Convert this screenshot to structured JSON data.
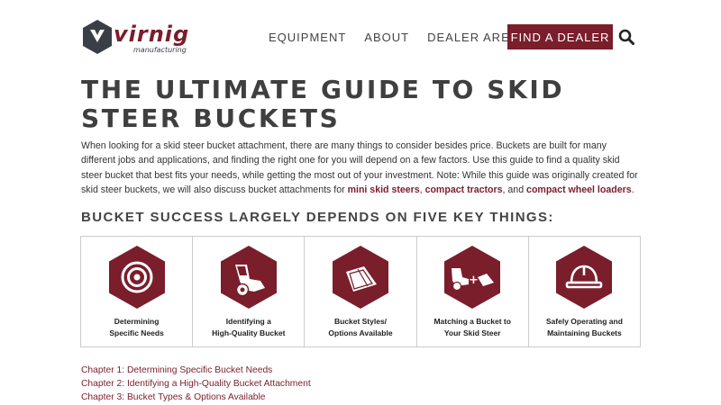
{
  "header": {
    "logo": {
      "wordmark": "virnig",
      "tagline": "manufacturing"
    },
    "nav": [
      "EQUIPMENT",
      "ABOUT",
      "DEALER AREA"
    ],
    "cta_label": "FIND A DEALER",
    "search_icon": "search-icon"
  },
  "page": {
    "title": "THE ULTIMATE GUIDE TO SKID STEER BUCKETS",
    "intro": {
      "text1": "When looking for a skid steer bucket attachment, there are many things to consider besides price. Buckets are built for many different jobs and applications, and finding the right one for you will depend on a few factors. Use this guide to find a quality skid steer bucket that best fits your needs, while getting the most out of your investment. Note: While this guide was originally created for skid steer buckets, we will also discuss bucket attachments for ",
      "link1": "mini skid steers",
      "sep1": ", ",
      "link2": "compact tractors",
      "sep2": ", and ",
      "link3": "compact wheel loaders",
      "end": "."
    },
    "subheading": "BUCKET SUCCESS LARGELY DEPENDS ON FIVE KEY THINGS:",
    "cards": [
      {
        "line1": "Determining",
        "line2": "Specific Needs",
        "icon": "target-icon"
      },
      {
        "line1": "Identifying a",
        "line2": "High-Quality Bucket",
        "icon": "bucket-icon"
      },
      {
        "line1": "Bucket Styles/",
        "line2": "Options Available",
        "icon": "bucket-styles-icon"
      },
      {
        "line1": "Matching a Bucket to",
        "line2": "Your Skid Steer",
        "icon": "skid-steer-match-icon"
      },
      {
        "line1": "Safely Operating and",
        "line2": "Maintaining Buckets",
        "icon": "hard-hat-icon"
      }
    ],
    "chapters": [
      "Chapter 1: Determining Specific Bucket Needs",
      "Chapter 2: Identifying a High-Quality Bucket Attachment",
      "Chapter 3: Bucket Types & Options Available"
    ]
  },
  "colors": {
    "brand": "#7a1e2c",
    "heading": "#3f3f3f",
    "logo_dark": "#3a3f47"
  }
}
